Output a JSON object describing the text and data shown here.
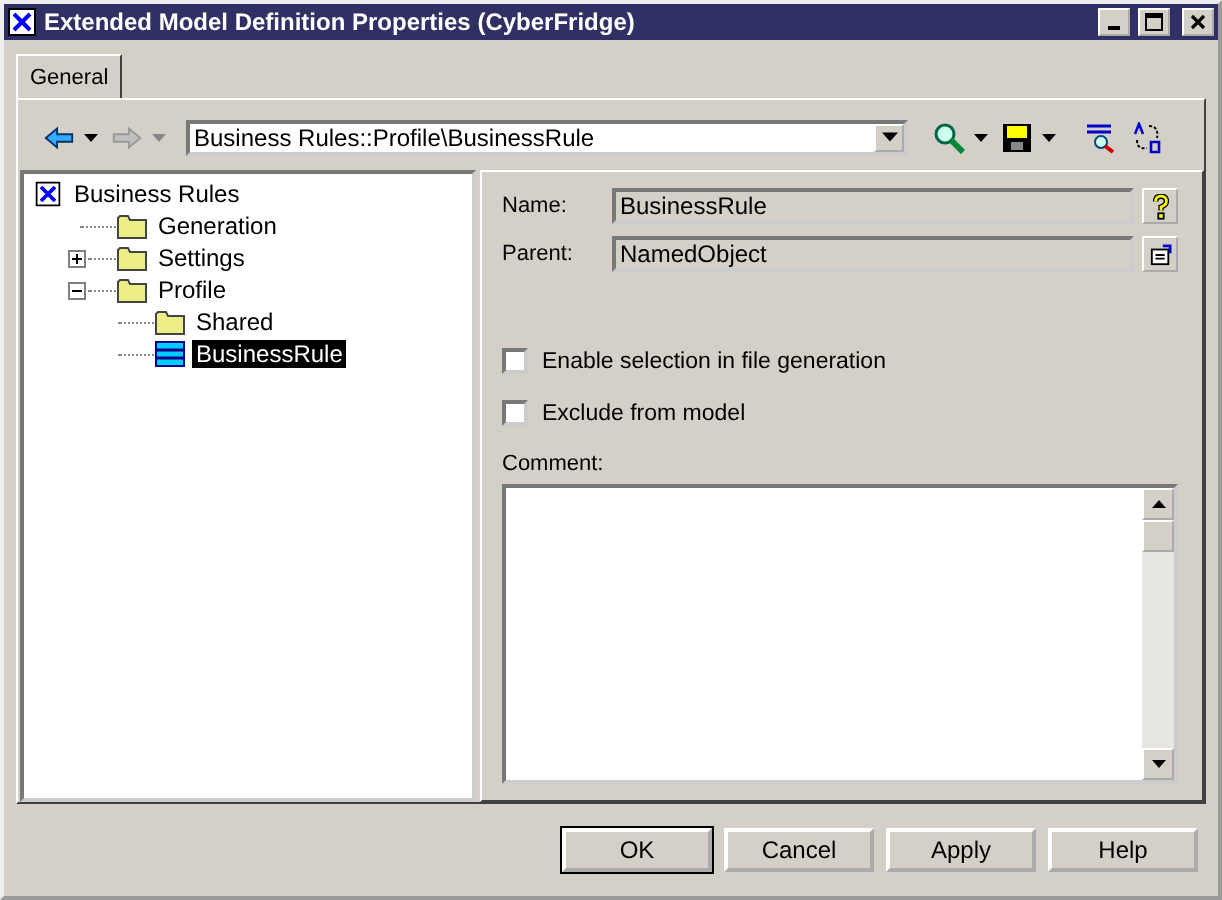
{
  "window": {
    "title": "Extended Model Definition Properties (CyberFridge)"
  },
  "tabs": [
    {
      "label": "General",
      "selected": true
    }
  ],
  "toolbar": {
    "back_disabled": false,
    "forward_disabled": true,
    "path": "Business Rules::Profile\\BusinessRule"
  },
  "tree": [
    {
      "label": "Business Rules",
      "kind": "model",
      "selected": false,
      "children": [
        {
          "label": "Generation",
          "kind": "folder",
          "selected": false
        },
        {
          "label": "Settings",
          "kind": "folder",
          "selected": false,
          "expanded": false
        },
        {
          "label": "Profile",
          "kind": "folder",
          "selected": false,
          "expanded": true,
          "children": [
            {
              "label": "Shared",
              "kind": "folder",
              "selected": false
            },
            {
              "label": "BusinessRule",
              "kind": "rule",
              "selected": true
            }
          ]
        }
      ]
    }
  ],
  "fields": [
    {
      "label": "Name:",
      "value": "BusinessRule",
      "kind": "help"
    },
    {
      "label": "Parent:",
      "value": "NamedObject",
      "kind": "properties"
    }
  ],
  "checks": [
    {
      "label": "Enable selection in file generation",
      "checked": false
    },
    {
      "label": "Exclude from model",
      "checked": false
    }
  ],
  "comment": {
    "label": "Comment:"
  },
  "buttons": [
    {
      "label": "OK",
      "default": true
    },
    {
      "label": "Cancel",
      "default": false
    },
    {
      "label": "Apply",
      "default": false
    },
    {
      "label": "Help",
      "default": false
    }
  ]
}
